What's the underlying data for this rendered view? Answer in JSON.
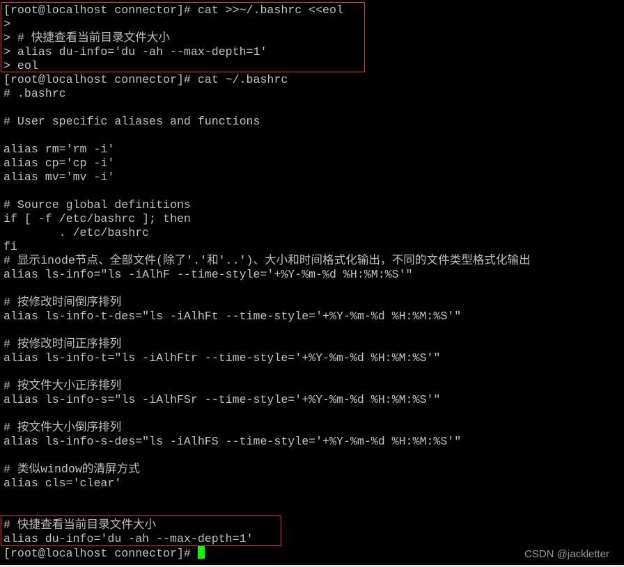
{
  "terminal": {
    "lines": [
      "[root@localhost connector]# cat >>~/.bashrc <<eol",
      ">",
      "> # 快捷查看当前目录文件大小",
      "> alias du-info='du -ah --max-depth=1'",
      "> eol",
      "[root@localhost connector]# cat ~/.bashrc",
      "# .bashrc",
      "",
      "# User specific aliases and functions",
      "",
      "alias rm='rm -i'",
      "alias cp='cp -i'",
      "alias mv='mv -i'",
      "",
      "# Source global definitions",
      "if [ -f /etc/bashrc ]; then",
      "        . /etc/bashrc",
      "fi",
      "# 显示inode节点、全部文件(除了'.'和'..')、大小和时间格式化输出，不同的文件类型格式化输出",
      "alias ls-info=\"ls -iAlhF --time-style='+%Y-%m-%d %H:%M:%S'\"",
      "",
      "# 按修改时间倒序排列",
      "alias ls-info-t-des=\"ls -iAlhFt --time-style='+%Y-%m-%d %H:%M:%S'\"",
      "",
      "# 按修改时间正序排列",
      "alias ls-info-t=\"ls -iAlhFtr --time-style='+%Y-%m-%d %H:%M:%S'\"",
      "",
      "# 按文件大小正序排列",
      "alias ls-info-s=\"ls -iAlhFSr --time-style='+%Y-%m-%d %H:%M:%S'\"",
      "",
      "# 按文件大小倒序排列",
      "alias ls-info-s-des=\"ls -iAlhFS --time-style='+%Y-%m-%d %H:%M:%S'\"",
      "",
      "# 类似window的清屏方式",
      "alias cls='clear'",
      "",
      "",
      "# 快捷查看当前目录文件大小",
      "alias du-info='du -ah --max-depth=1'"
    ],
    "prompt": "[root@localhost connector]# ",
    "cursor_color": "#00ff00",
    "highlight_color": "#e03030"
  },
  "watermark": "CSDN @jackletter"
}
